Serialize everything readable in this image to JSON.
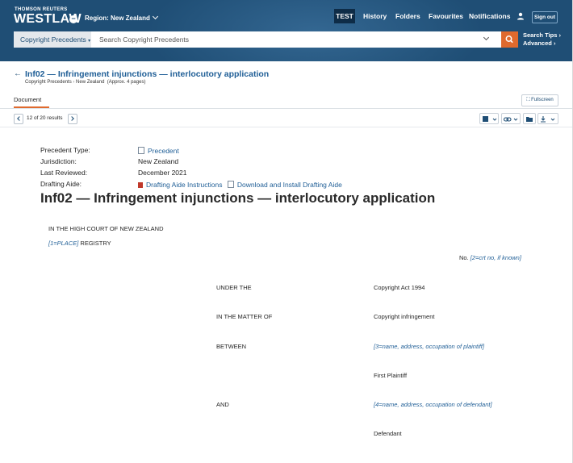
{
  "header": {
    "brand_top": "THOMSON REUTERS",
    "brand_main": "WESTLAW",
    "region": "Region: New Zealand",
    "nav": [
      "TEST",
      "History",
      "Folders",
      "Favourites",
      "Notifications"
    ],
    "sign_out": "Sign out"
  },
  "search": {
    "scope": "Copyright Precedents",
    "placeholder": "Search Copyright Precedents",
    "tips": "Search Tips",
    "advanced": "Advanced"
  },
  "document_header": {
    "title": "Inf02 — Infringement injunctions — interlocutory application",
    "crumb_collection": "Copyright Precedents",
    "crumb_jurisdiction": "New Zealand",
    "crumb_pages": "(Approx. 4 pages)",
    "tab": "Document",
    "fullscreen": "Fullscreen"
  },
  "results_nav": {
    "text": "12 of 20 results"
  },
  "metadata": [
    {
      "label": "Precedent Type:",
      "value": "Precedent"
    },
    {
      "label": "Jurisdiction:",
      "value": "New Zealand"
    },
    {
      "label": "Last Reviewed:",
      "value": "December 2021"
    },
    {
      "label": "Drafting Aide:",
      "value": "Drafting Aide Instructions",
      "value2": "Download and Install Drafting Aide"
    }
  ],
  "document": {
    "heading": "Inf02 — Infringement injunctions — interlocutory application",
    "court": "IN THE HIGH COURT OF NEW ZEALAND",
    "place_ph": "[1=PLACE]",
    "registry": "REGISTRY",
    "no_label": "No.",
    "no_ph": "[2=crt no, if known]",
    "rows": [
      {
        "left": "UNDER THE",
        "right": "Copyright Act 1994",
        "placeholder": false
      },
      {
        "left": "IN THE MATTER OF",
        "right": "Copyright infringement",
        "placeholder": false
      },
      {
        "left": "BETWEEN",
        "right": "[3=name, address, occupation of plaintiff]",
        "placeholder": true
      },
      {
        "left": "",
        "right": "First Plaintiff",
        "placeholder": false
      },
      {
        "left": "AND",
        "right": "[4=name, address, occupation of defendant]",
        "placeholder": true
      },
      {
        "left": "",
        "right": "Defendant",
        "placeholder": false
      }
    ]
  },
  "colors": {
    "header_bg": "#1f4e75",
    "accent": "#e06a2e",
    "link": "#1f5e96"
  }
}
